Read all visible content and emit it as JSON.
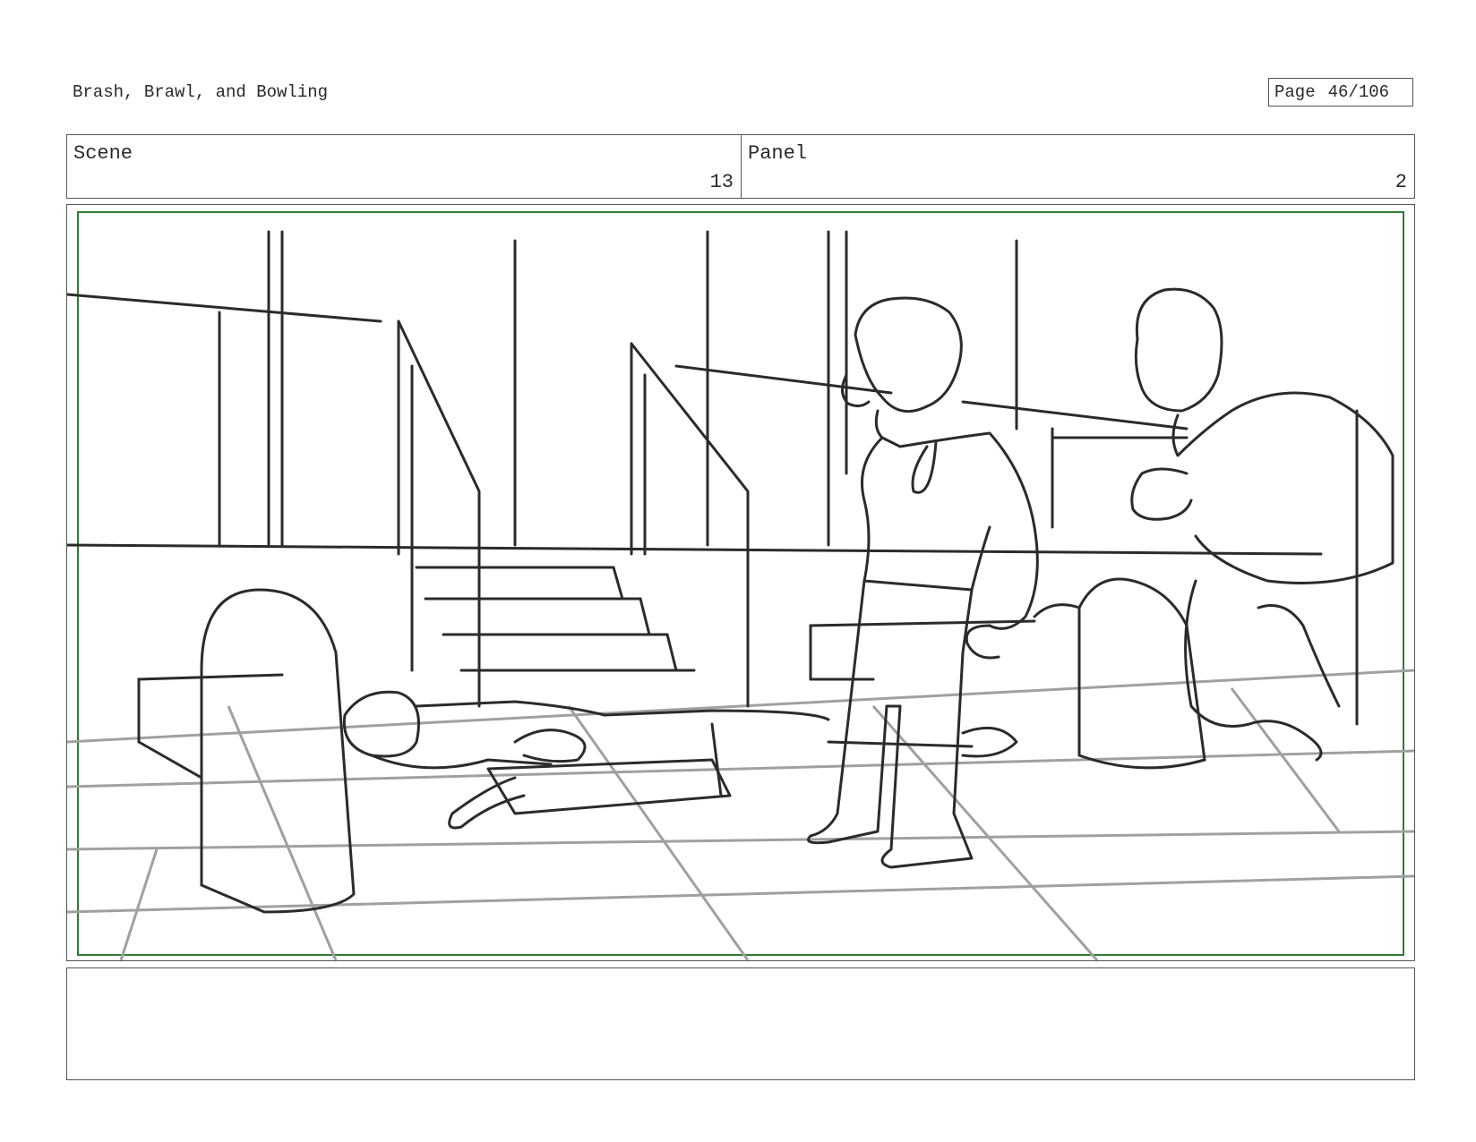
{
  "header": {
    "title": "Brash, Brawl, and Bowling",
    "page_label": "Page",
    "page_value": "46/106"
  },
  "info": {
    "scene_label": "Scene",
    "scene_value": "13",
    "panel_label": "Panel",
    "panel_value": "2"
  },
  "frame": {
    "safe_area_color": "#2e7d32",
    "sketch_color": "#2b2b2b",
    "guide_color": "#9a9a9a"
  },
  "notes": {
    "text": ""
  }
}
